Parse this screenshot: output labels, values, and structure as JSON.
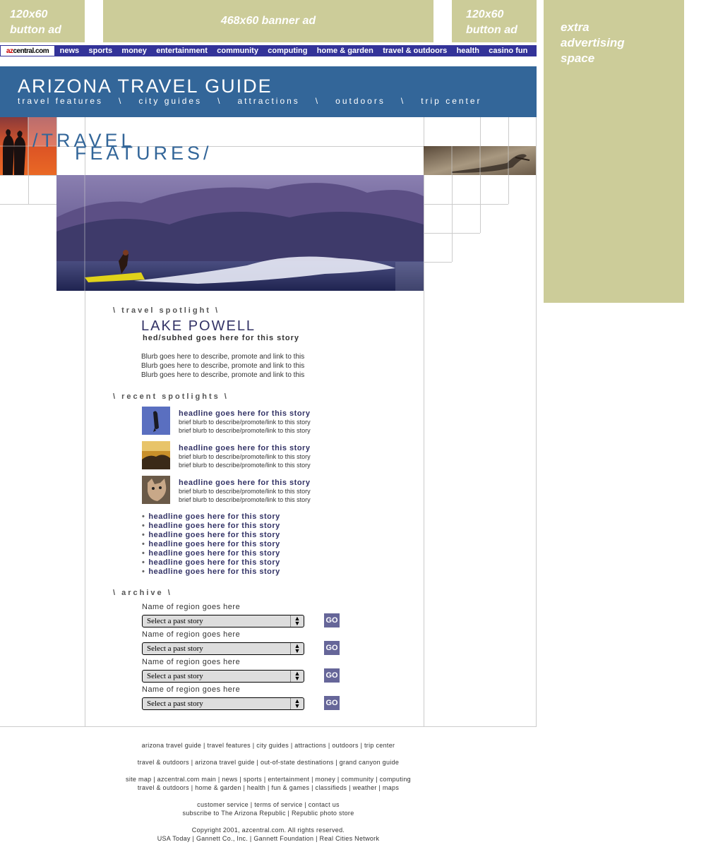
{
  "ads": {
    "left_button": "120x60\nbutton ad",
    "banner": "468x60 banner ad",
    "right_button": "120x60\nbutton ad",
    "extra": "extra\nadvertising\nspace"
  },
  "topnav": {
    "logo": "azcentral.com",
    "logo_prefix": "az",
    "logo_suffix": "central.com",
    "links": [
      "news",
      "sports",
      "money",
      "entertainment",
      "community",
      "computing",
      "home & garden",
      "travel & outdoors",
      "health",
      "casino fun"
    ]
  },
  "header": {
    "title": "ARIZONA TRAVEL GUIDE",
    "subnav": [
      "travel features",
      "\\",
      "city guides",
      "\\",
      "attractions",
      "\\",
      "outdoors",
      "\\",
      "trip center"
    ]
  },
  "section": {
    "title_line1": "/TRAVEL",
    "title_line2": "FEATURES/"
  },
  "spotlight": {
    "heading": "\\ travel spotlight \\",
    "title": "LAKE POWELL",
    "hed": "hed/subhed goes here for this story",
    "blurbs": [
      "Blurb goes here to describe, promote and link to this",
      "Blurb goes here to describe, promote and link to this",
      "Blurb goes here to describe, promote and link to this"
    ]
  },
  "recent": {
    "heading": "\\ recent spotlights \\",
    "items": [
      {
        "headline": "headline goes here for this story",
        "blurb1": "brief blurb to describe/promote/link to this story",
        "blurb2": "brief blurb to describe/promote/link to this story"
      },
      {
        "headline": "headline goes here for this story",
        "blurb1": "brief blurb to describe/promote/link to this story",
        "blurb2": "brief blurb to describe/promote/link to this story"
      },
      {
        "headline": "headline goes here for this story",
        "blurb1": "brief blurb to describe/promote/link to this story",
        "blurb2": "brief blurb to describe/promote/link to this story"
      }
    ],
    "links": [
      "headline goes here for this story",
      "headline goes here for this story",
      "headline goes here for this story",
      "headline goes here for this story",
      "headline goes here for this story",
      "headline goes here for this story",
      "headline goes here for this story"
    ]
  },
  "archive": {
    "heading": "\\ archive \\",
    "regions": [
      {
        "name": "Name of region goes here",
        "select": "Select a past story",
        "go": "GO"
      },
      {
        "name": "Name of region goes here",
        "select": "Select a past story",
        "go": "GO"
      },
      {
        "name": "Name of region goes here",
        "select": "Select a past story",
        "go": "GO"
      },
      {
        "name": "Name of region goes here",
        "select": "Select a past story",
        "go": "GO"
      }
    ]
  },
  "footer": {
    "line1": "arizona travel guide | travel features | city guides | attractions | outdoors | trip center",
    "line2": "travel & outdoors | arizona travel guide | out-of-state destinations | grand canyon guide",
    "line3a": "site map | azcentral.com main | news | sports | entertainment | money | community | computing",
    "line3b": "travel & outdoors | home & garden | health | fun & games | classifieds | weather | maps",
    "line4a": "customer service | terms of service | contact us",
    "line4b": "subscribe to The Arizona Republic | Republic photo store",
    "line5a": "Copyright 2001, azcentral.com. All rights reserved.",
    "line5b": "USA Today | Gannett Co., Inc. | Gannett Foundation | Real Cities Network"
  },
  "colors": {
    "ad": "#cccc99",
    "nav": "#333399",
    "header": "#336699",
    "go": "#666699"
  }
}
